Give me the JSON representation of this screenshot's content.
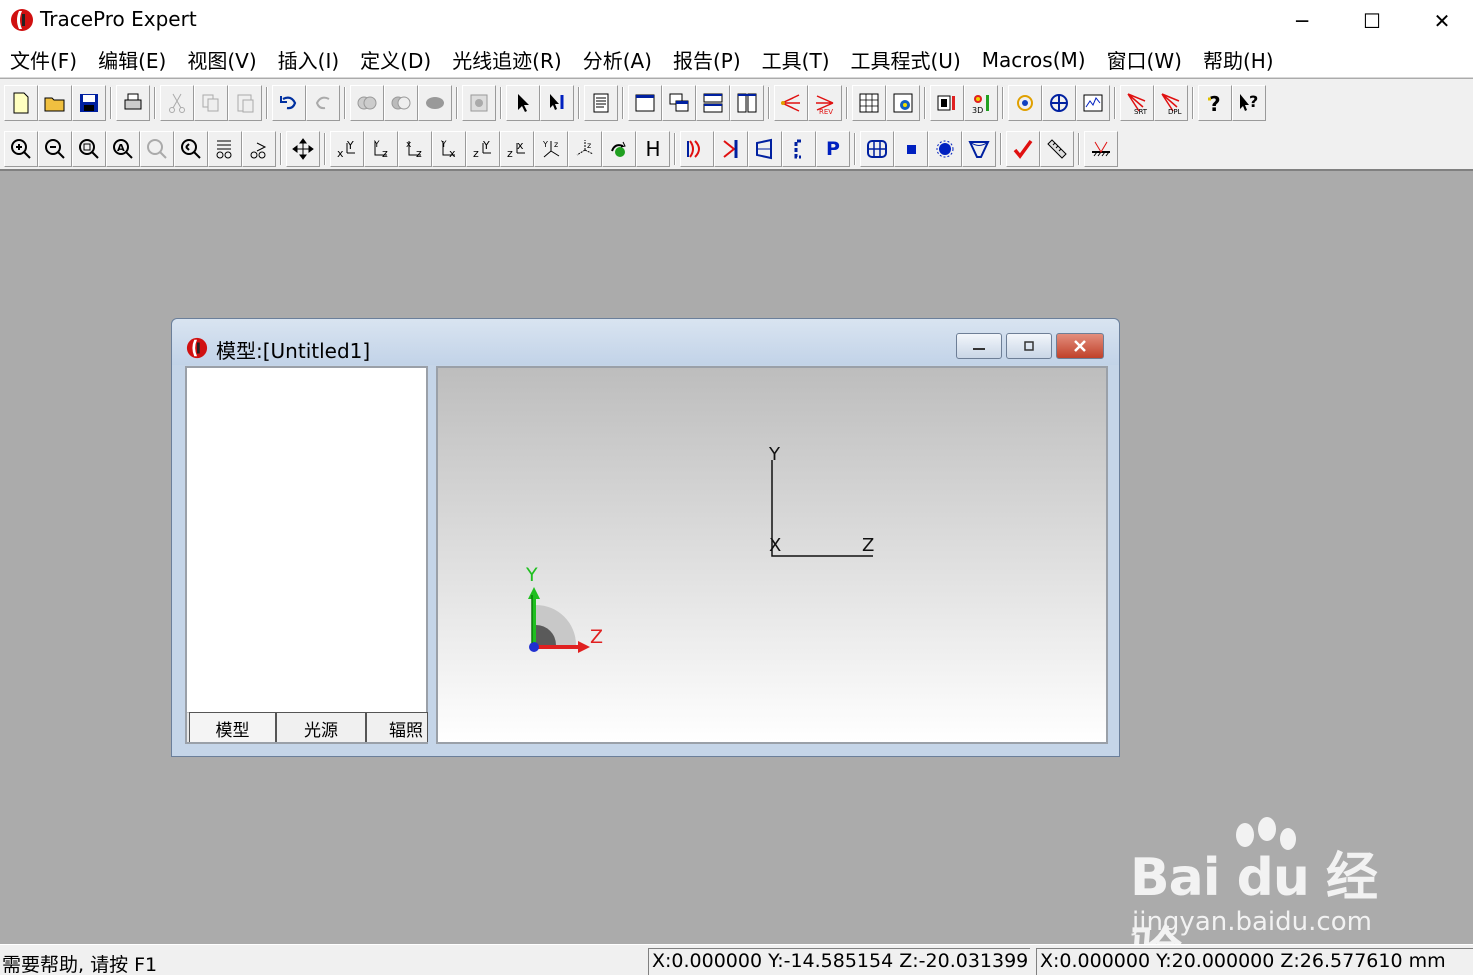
{
  "window": {
    "title": "TracePro Expert",
    "minimize": "─",
    "maximize": "☐",
    "close": "✕"
  },
  "menu": [
    "文件(F)",
    "编辑(E)",
    "视图(V)",
    "插入(I)",
    "定义(D)",
    "光线追迹(R)",
    "分析(A)",
    "报告(P)",
    "工具(T)",
    "工具程式(U)",
    "Macros(M)",
    "窗口(W)",
    "帮助(H)"
  ],
  "toolbar": {
    "h_button": "H",
    "p_button": "P"
  },
  "child_window": {
    "title": "模型:[Untitled1]",
    "tabs": [
      "模型",
      "光源",
      "辐照"
    ]
  },
  "viewport": {
    "axis_y": "Y",
    "axis_z": "Z",
    "axis_x": "X",
    "triad_y": "Y",
    "triad_z": "Z"
  },
  "status": {
    "help": "需要帮助, 请按 F1",
    "cursor_coords": "X:0.000000 Y:-14.585154 Z:-20.031399",
    "view_coords": "X:0.000000 Y:20.000000 Z:26.577610 mm"
  },
  "watermark": {
    "brand": "Bai du 经验",
    "url": "jingyan.baidu.com"
  },
  "colors": {
    "workspace": "#ababab",
    "axis_green": "#1fbf1f",
    "axis_red": "#e02020",
    "axis_blue": "#2030d0"
  }
}
